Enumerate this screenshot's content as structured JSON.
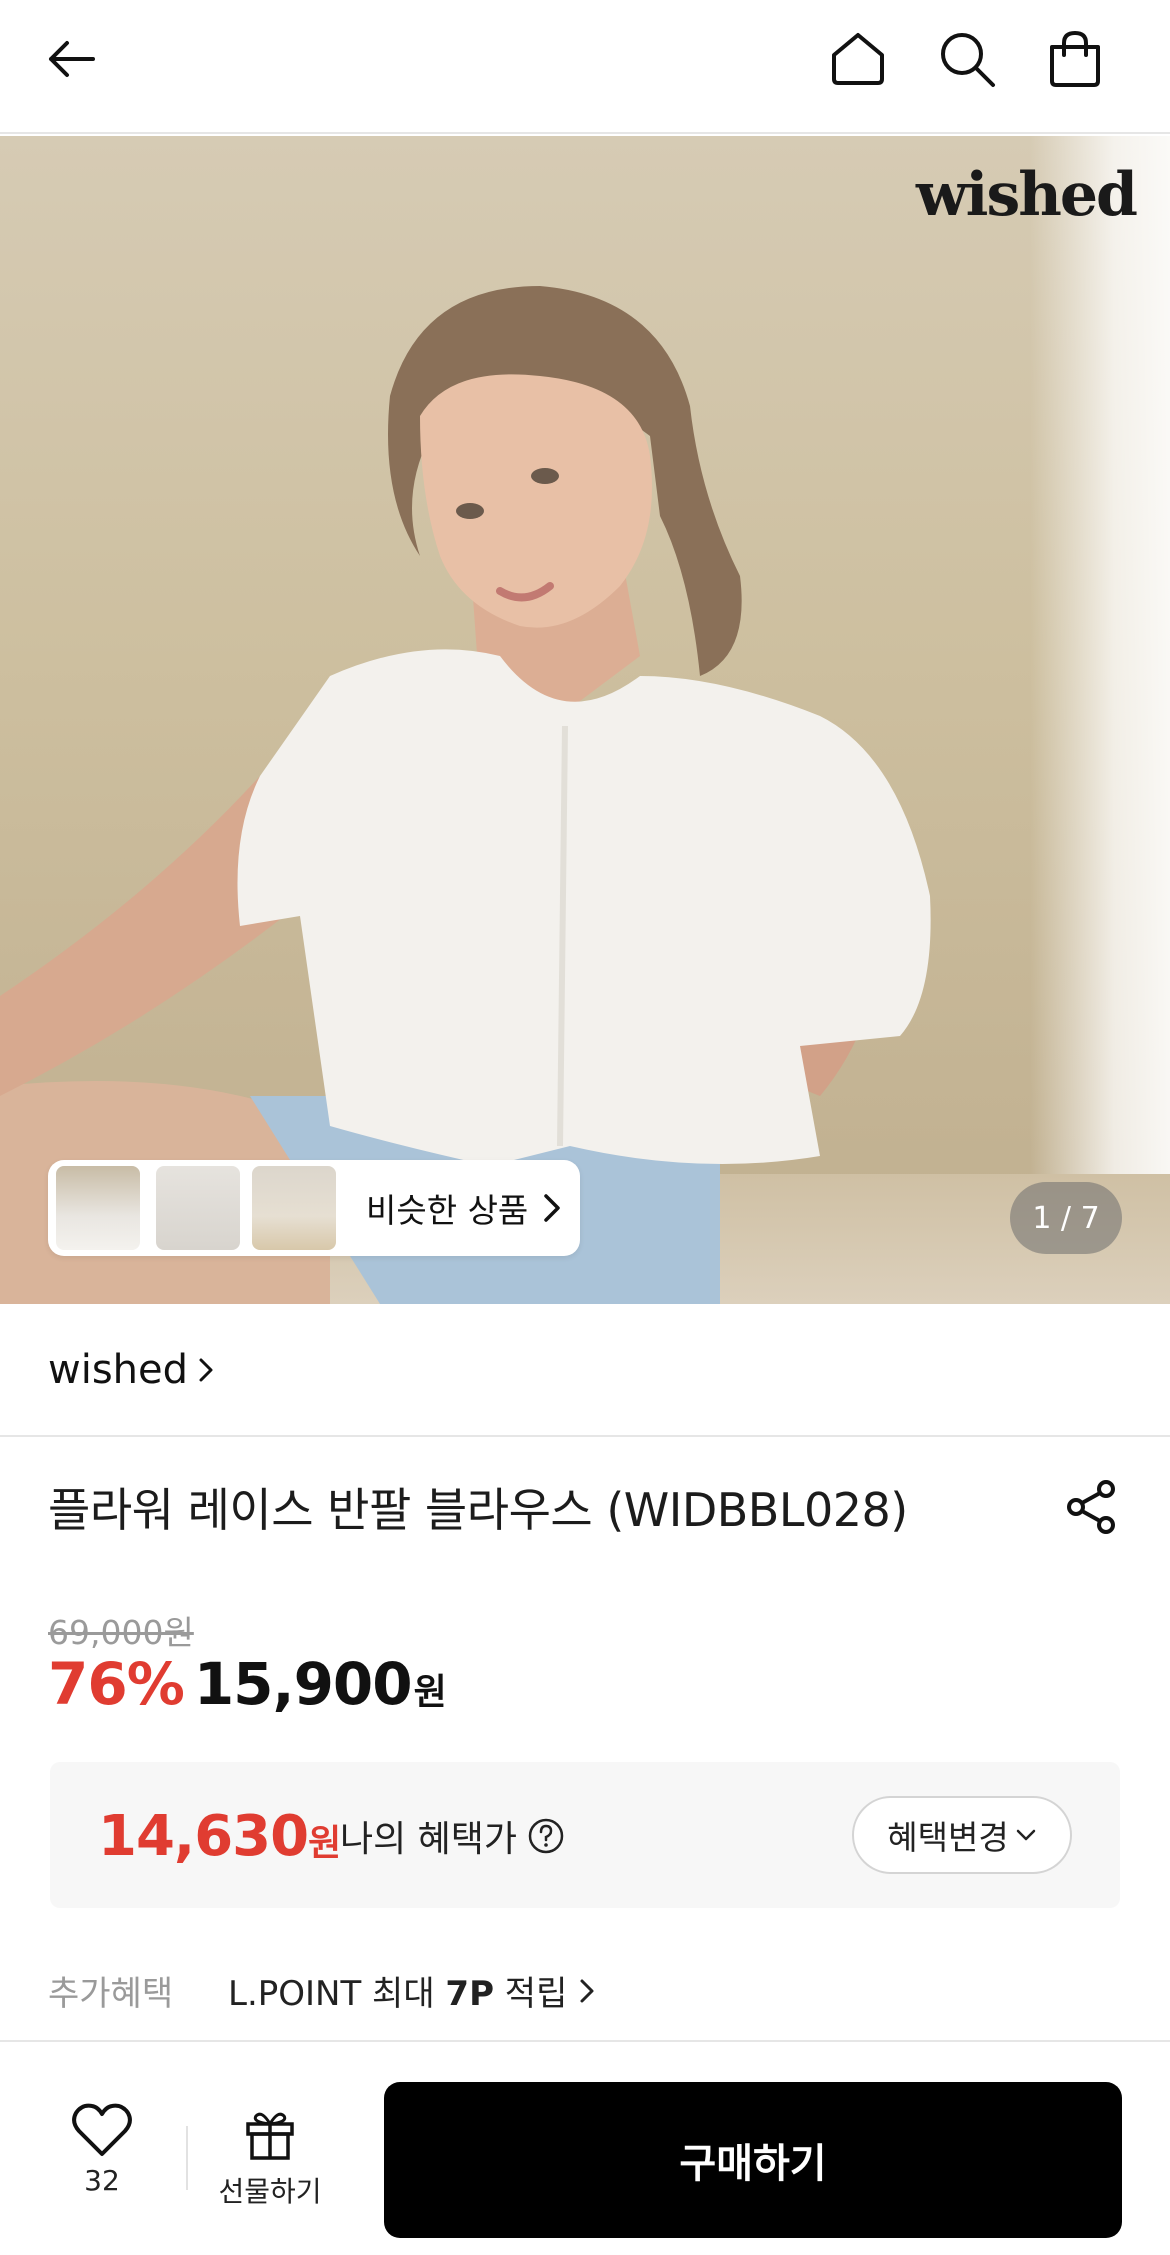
{
  "header": {
    "back_icon": "arrow-left-icon",
    "home_icon": "home-icon",
    "search_icon": "search-icon",
    "cart_icon": "shopping-bag-icon"
  },
  "hero": {
    "brand_watermark": "wished",
    "similar_label": "비슷한 상품",
    "counter": "1 / 7"
  },
  "brand": {
    "name": "wished"
  },
  "product": {
    "title": "플라워 레이스 반팔 블라우스 (WIDBBL028)",
    "original_price": "69,000원",
    "discount": "76%",
    "price": "15,900",
    "currency": "원"
  },
  "benefit": {
    "price": "14,630",
    "currency": "원",
    "label": "나의 혜택가",
    "change_button": "혜택변경"
  },
  "extra": {
    "label": "추가혜택",
    "text_prefix": "L.POINT 최대 ",
    "text_bold": "7P",
    "text_suffix": " 적립"
  },
  "bottom": {
    "like_count": "32",
    "gift_label": "선물하기",
    "buy_label": "구매하기"
  }
}
